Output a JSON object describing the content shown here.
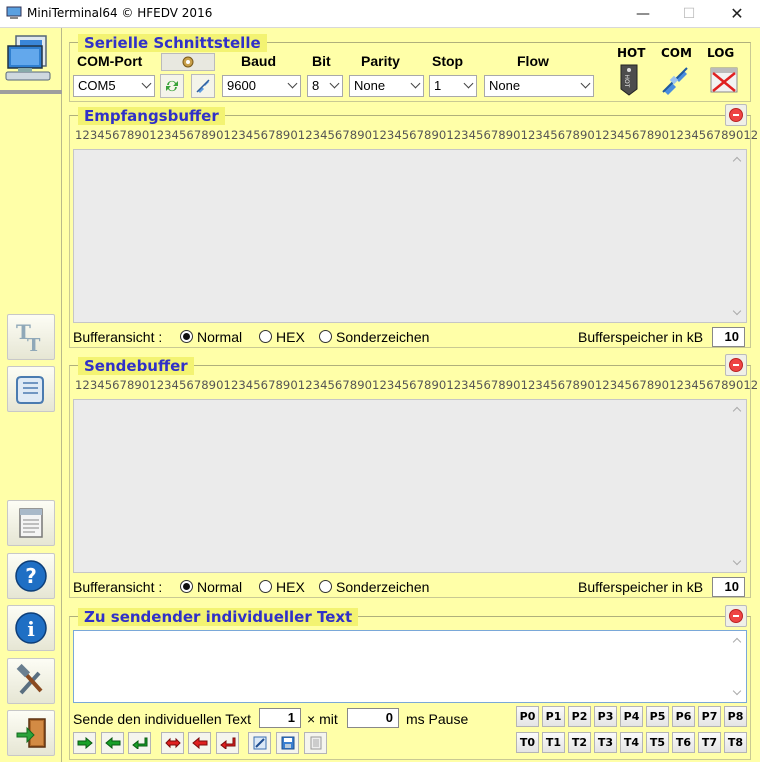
{
  "window": {
    "title": "MiniTerminal64 © HFEDV 2016",
    "min_glyph": "—",
    "max_glyph": "☐",
    "close_glyph": "✕"
  },
  "serial": {
    "group_title": "Serielle Schnittstelle",
    "headers": {
      "com_port": "COM-Port",
      "baud": "Baud",
      "bit": "Bit",
      "parity": "Parity",
      "stop": "Stop",
      "flow": "Flow"
    },
    "values": {
      "com_port": "COM5",
      "baud": "9600",
      "bit": "8",
      "parity": "None",
      "stop": "1",
      "flow": "None"
    },
    "tool_labels": {
      "hot": "HOT",
      "com": "COM",
      "log": "LOG"
    }
  },
  "ruler": "12345678901234567890123456789012345678901234567890123456789012345678901234567890123456789012",
  "receive": {
    "group_title": "Empfangsbuffer",
    "view_label": "Bufferansicht :",
    "options": [
      "Normal",
      "HEX",
      "Sonderzeichen"
    ],
    "selected": "Normal",
    "memory_label": "Bufferspeicher in kB",
    "memory_value": "10"
  },
  "send": {
    "group_title": "Sendebuffer",
    "view_label": "Bufferansicht :",
    "options": [
      "Normal",
      "HEX",
      "Sonderzeichen"
    ],
    "selected": "Normal",
    "memory_label": "Bufferspeicher in kB",
    "memory_value": "10"
  },
  "custom": {
    "group_title": "Zu sendender individueller Text",
    "send_label": "Sende den individuellen Text",
    "times_value": "1",
    "times_label": "× mit",
    "pause_value": "0",
    "pause_label": "ms Pause",
    "p_buttons": [
      "P0",
      "P1",
      "P2",
      "P3",
      "P4",
      "P5",
      "P6",
      "P7",
      "P8"
    ],
    "t_buttons": [
      "T0",
      "T1",
      "T2",
      "T3",
      "T4",
      "T5",
      "T6",
      "T7",
      "T8"
    ]
  },
  "colors": {
    "background": "#ffffa8",
    "group_title_bg": "#f3f372",
    "group_title_text": "#3030c8"
  }
}
